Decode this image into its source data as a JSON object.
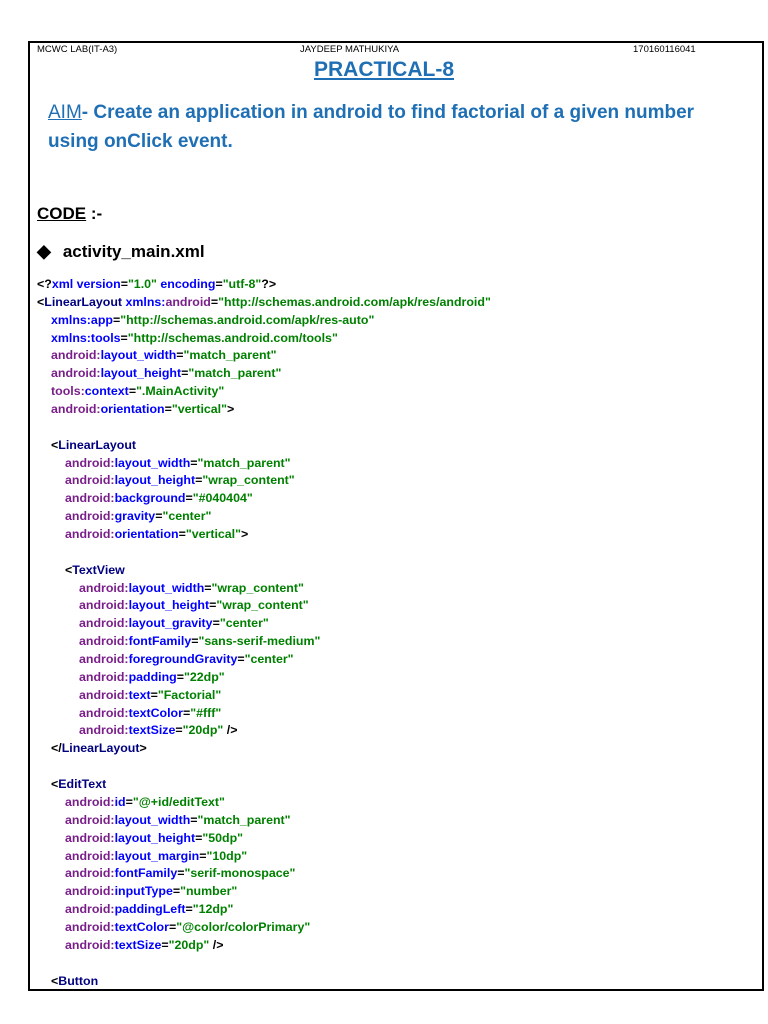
{
  "header": {
    "left": "MCWC LAB(IT-A3)",
    "center": "JAYDEEP MATHUKIYA",
    "right": "170160116041"
  },
  "title": "PRACTICAL-8",
  "aim": {
    "label": "AIM",
    "text": "- Create an application in android to find factorial of a given number using onClick event."
  },
  "code_heading": {
    "label": "CODE",
    "suffix": " :-"
  },
  "file": {
    "bullet": "◆",
    "name": "activity_main.xml"
  },
  "code_lines": [
    {
      "i": 0,
      "t": [
        [
          "b",
          "<?"
        ],
        [
          "a",
          "xml version"
        ],
        [
          "b",
          "="
        ],
        [
          "v",
          "\"1.0\""
        ],
        [
          "a",
          " encoding"
        ],
        [
          "b",
          "="
        ],
        [
          "v",
          "\"utf-8\""
        ],
        [
          "b",
          "?>"
        ]
      ]
    },
    {
      "i": 0,
      "t": [
        [
          "b",
          "<"
        ],
        [
          "n",
          "LinearLayout "
        ],
        [
          "a",
          "xmlns:"
        ],
        [
          "p",
          "android"
        ],
        [
          "b",
          "="
        ],
        [
          "v",
          "\"http://schemas.android.com/apk/res/android\""
        ]
      ]
    },
    {
      "i": 1,
      "t": [
        [
          "a",
          "xmlns:app"
        ],
        [
          "b",
          "="
        ],
        [
          "v",
          "\"http://schemas.android.com/apk/res-auto\""
        ]
      ]
    },
    {
      "i": 1,
      "t": [
        [
          "a",
          "xmlns:tools"
        ],
        [
          "b",
          "="
        ],
        [
          "v",
          "\"http://schemas.android.com/tools\""
        ]
      ]
    },
    {
      "i": 1,
      "t": [
        [
          "p",
          "android:"
        ],
        [
          "a",
          "layout_width"
        ],
        [
          "b",
          "="
        ],
        [
          "v",
          "\"match_parent\""
        ]
      ]
    },
    {
      "i": 1,
      "t": [
        [
          "p",
          "android:"
        ],
        [
          "a",
          "layout_height"
        ],
        [
          "b",
          "="
        ],
        [
          "v",
          "\"match_parent\""
        ]
      ]
    },
    {
      "i": 1,
      "t": [
        [
          "p",
          "tools:"
        ],
        [
          "a",
          "context"
        ],
        [
          "b",
          "="
        ],
        [
          "v",
          "\".MainActivity\""
        ]
      ]
    },
    {
      "i": 1,
      "t": [
        [
          "p",
          "android:"
        ],
        [
          "a",
          "orientation"
        ],
        [
          "b",
          "="
        ],
        [
          "v",
          "\"vertical\""
        ],
        [
          "b",
          ">"
        ]
      ]
    },
    {
      "i": 0,
      "t": []
    },
    {
      "i": 1,
      "t": [
        [
          "b",
          "<"
        ],
        [
          "n",
          "LinearLayout"
        ]
      ]
    },
    {
      "i": 2,
      "t": [
        [
          "p",
          "android:"
        ],
        [
          "a",
          "layout_width"
        ],
        [
          "b",
          "="
        ],
        [
          "v",
          "\"match_parent\""
        ]
      ]
    },
    {
      "i": 2,
      "t": [
        [
          "p",
          "android:"
        ],
        [
          "a",
          "layout_height"
        ],
        [
          "b",
          "="
        ],
        [
          "v",
          "\"wrap_content\""
        ]
      ]
    },
    {
      "i": 2,
      "t": [
        [
          "p",
          "android:"
        ],
        [
          "a",
          "background"
        ],
        [
          "b",
          "="
        ],
        [
          "v",
          "\"#040404\""
        ]
      ]
    },
    {
      "i": 2,
      "t": [
        [
          "p",
          "android:"
        ],
        [
          "a",
          "gravity"
        ],
        [
          "b",
          "="
        ],
        [
          "v",
          "\"center\""
        ]
      ]
    },
    {
      "i": 2,
      "t": [
        [
          "p",
          "android:"
        ],
        [
          "a",
          "orientation"
        ],
        [
          "b",
          "="
        ],
        [
          "v",
          "\"vertical\""
        ],
        [
          "b",
          ">"
        ]
      ]
    },
    {
      "i": 0,
      "t": []
    },
    {
      "i": 2,
      "t": [
        [
          "b",
          "<"
        ],
        [
          "n",
          "TextView"
        ]
      ]
    },
    {
      "i": 3,
      "t": [
        [
          "p",
          "android:"
        ],
        [
          "a",
          "layout_width"
        ],
        [
          "b",
          "="
        ],
        [
          "v",
          "\"wrap_content\""
        ]
      ]
    },
    {
      "i": 3,
      "t": [
        [
          "p",
          "android:"
        ],
        [
          "a",
          "layout_height"
        ],
        [
          "b",
          "="
        ],
        [
          "v",
          "\"wrap_content\""
        ]
      ]
    },
    {
      "i": 3,
      "t": [
        [
          "p",
          "android:"
        ],
        [
          "a",
          "layout_gravity"
        ],
        [
          "b",
          "="
        ],
        [
          "v",
          "\"center\""
        ]
      ]
    },
    {
      "i": 3,
      "t": [
        [
          "p",
          "android:"
        ],
        [
          "a",
          "fontFamily"
        ],
        [
          "b",
          "="
        ],
        [
          "v",
          "\"sans-serif-medium\""
        ]
      ]
    },
    {
      "i": 3,
      "t": [
        [
          "p",
          "android:"
        ],
        [
          "a",
          "foregroundGravity"
        ],
        [
          "b",
          "="
        ],
        [
          "v",
          "\"center\""
        ]
      ]
    },
    {
      "i": 3,
      "t": [
        [
          "p",
          "android:"
        ],
        [
          "a",
          "padding"
        ],
        [
          "b",
          "="
        ],
        [
          "v",
          "\"22dp\""
        ]
      ]
    },
    {
      "i": 3,
      "t": [
        [
          "p",
          "android:"
        ],
        [
          "a",
          "text"
        ],
        [
          "b",
          "="
        ],
        [
          "v",
          "\"Factorial\""
        ]
      ]
    },
    {
      "i": 3,
      "t": [
        [
          "p",
          "android:"
        ],
        [
          "a",
          "textColor"
        ],
        [
          "b",
          "="
        ],
        [
          "v",
          "\"#fff\""
        ]
      ]
    },
    {
      "i": 3,
      "t": [
        [
          "p",
          "android:"
        ],
        [
          "a",
          "textSize"
        ],
        [
          "b",
          "="
        ],
        [
          "v",
          "\"20dp\""
        ],
        [
          "b",
          " />"
        ]
      ]
    },
    {
      "i": 1,
      "t": [
        [
          "b",
          "</"
        ],
        [
          "n",
          "LinearLayout"
        ],
        [
          "b",
          ">"
        ]
      ]
    },
    {
      "i": 0,
      "t": []
    },
    {
      "i": 1,
      "t": [
        [
          "b",
          "<"
        ],
        [
          "n",
          "EditText"
        ]
      ]
    },
    {
      "i": 2,
      "t": [
        [
          "p",
          "android:"
        ],
        [
          "a",
          "id"
        ],
        [
          "b",
          "="
        ],
        [
          "v",
          "\"@+id/editText\""
        ]
      ]
    },
    {
      "i": 2,
      "t": [
        [
          "p",
          "android:"
        ],
        [
          "a",
          "layout_width"
        ],
        [
          "b",
          "="
        ],
        [
          "v",
          "\"match_parent\""
        ]
      ]
    },
    {
      "i": 2,
      "t": [
        [
          "p",
          "android:"
        ],
        [
          "a",
          "layout_height"
        ],
        [
          "b",
          "="
        ],
        [
          "v",
          "\"50dp\""
        ]
      ]
    },
    {
      "i": 2,
      "t": [
        [
          "p",
          "android:"
        ],
        [
          "a",
          "layout_margin"
        ],
        [
          "b",
          "="
        ],
        [
          "v",
          "\"10dp\""
        ]
      ]
    },
    {
      "i": 2,
      "t": [
        [
          "p",
          "android:"
        ],
        [
          "a",
          "fontFamily"
        ],
        [
          "b",
          "="
        ],
        [
          "v",
          "\"serif-monospace\""
        ]
      ]
    },
    {
      "i": 2,
      "t": [
        [
          "p",
          "android:"
        ],
        [
          "a",
          "inputType"
        ],
        [
          "b",
          "="
        ],
        [
          "v",
          "\"number\""
        ]
      ]
    },
    {
      "i": 2,
      "t": [
        [
          "p",
          "android:"
        ],
        [
          "a",
          "paddingLeft"
        ],
        [
          "b",
          "="
        ],
        [
          "v",
          "\"12dp\""
        ]
      ]
    },
    {
      "i": 2,
      "t": [
        [
          "p",
          "android:"
        ],
        [
          "a",
          "textColor"
        ],
        [
          "b",
          "="
        ],
        [
          "v",
          "\"@color/colorPrimary\""
        ]
      ]
    },
    {
      "i": 2,
      "t": [
        [
          "p",
          "android:"
        ],
        [
          "a",
          "textSize"
        ],
        [
          "b",
          "="
        ],
        [
          "v",
          "\"20dp\""
        ],
        [
          "b",
          " />"
        ]
      ]
    },
    {
      "i": 0,
      "t": []
    },
    {
      "i": 1,
      "t": [
        [
          "b",
          "<"
        ],
        [
          "n",
          "Button"
        ]
      ]
    }
  ]
}
